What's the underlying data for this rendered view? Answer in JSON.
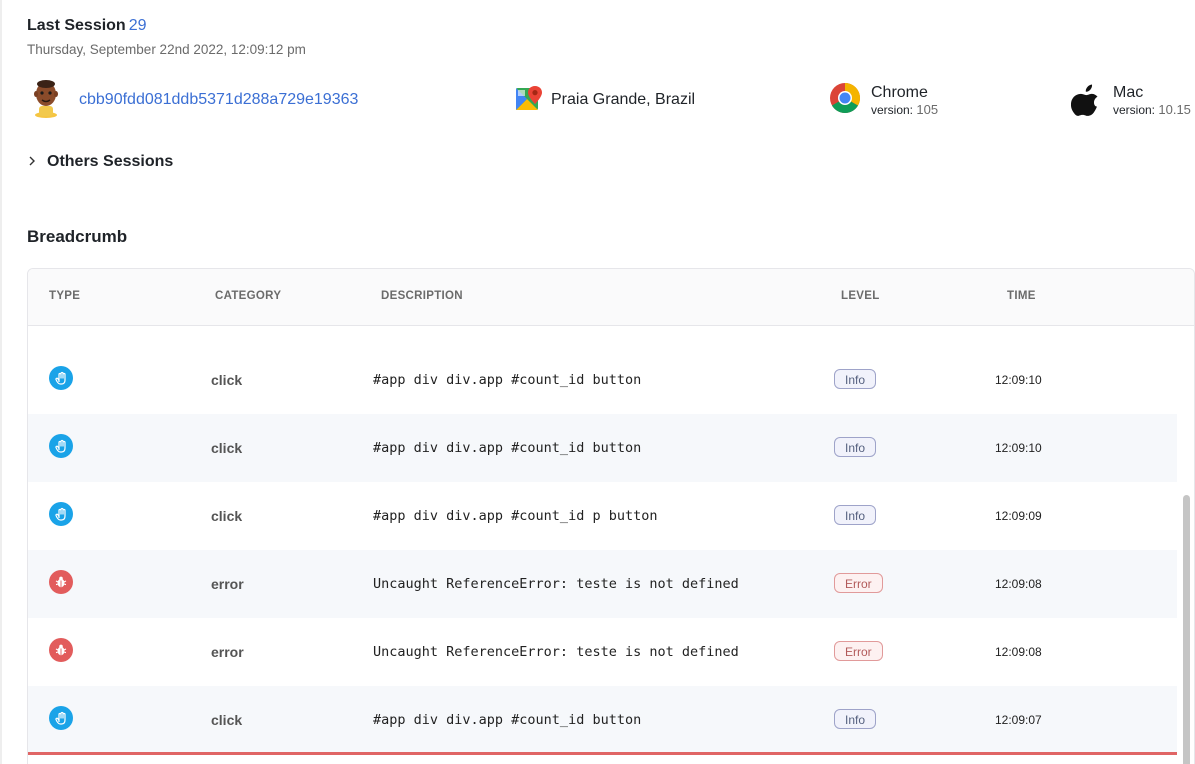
{
  "session": {
    "title": "Last Session",
    "count": "29",
    "date": "Thursday, September 22nd 2022, 12:09:12 pm",
    "user_id": "cbb90fdd081ddb5371d288a729e19363",
    "location": "Praia Grande, Brazil",
    "browser": {
      "name": "Chrome",
      "version_label": "version:",
      "version": "105"
    },
    "os": {
      "name": "Mac",
      "version_label": "version:",
      "version": "10.15"
    }
  },
  "others": {
    "label": "Others Sessions"
  },
  "breadcrumb": {
    "title": "Breadcrumb",
    "columns": {
      "type": "TYPE",
      "category": "CATEGORY",
      "description": "DESCRIPTION",
      "level": "LEVEL",
      "time": "TIME"
    },
    "rows": [
      {
        "category": "click",
        "description": "#app div div.app #count_id button",
        "level": "Info",
        "time": "12:09:10"
      },
      {
        "category": "click",
        "description": "#app div div.app #count_id button",
        "level": "Info",
        "time": "12:09:10"
      },
      {
        "category": "click",
        "description": "#app div div.app #count_id p button",
        "level": "Info",
        "time": "12:09:09"
      },
      {
        "category": "error",
        "description": "Uncaught ReferenceError: teste is not defined",
        "level": "Error",
        "time": "12:09:08"
      },
      {
        "category": "error",
        "description": "Uncaught ReferenceError: teste is not defined",
        "level": "Error",
        "time": "12:09:08"
      },
      {
        "category": "click",
        "description": "#app div div.app #count_id button",
        "level": "Info",
        "time": "12:09:07"
      }
    ]
  },
  "colors": {
    "accent": "#3b6fd4",
    "click_icon": "#1aa3e8",
    "error_icon": "#e25c5c"
  },
  "icons": {
    "user": "avatar-icon",
    "location": "google-maps-icon",
    "browser": "chrome-icon",
    "os": "apple-icon",
    "chevron": "chevron-right-icon",
    "click": "pointer-hand-icon",
    "error": "bug-icon"
  }
}
